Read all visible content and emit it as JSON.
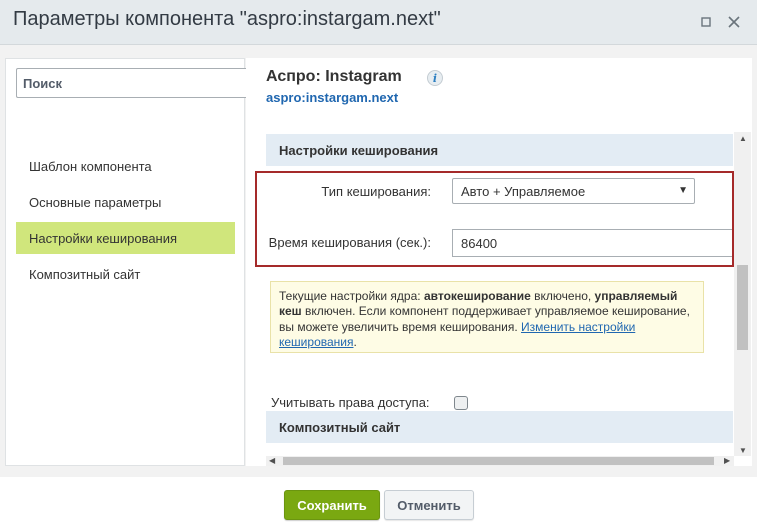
{
  "window": {
    "title": "Параметры компонента \"aspro:instargam.next\"",
    "maximize_icon": "maximize-icon",
    "close_icon": "close-icon"
  },
  "sidebar": {
    "search_placeholder": "Поиск",
    "items": [
      {
        "label": "Шаблон компонента",
        "active": false
      },
      {
        "label": "Основные параметры",
        "active": false
      },
      {
        "label": "Настройки кеширования",
        "active": true
      },
      {
        "label": "Композитный сайт",
        "active": false
      }
    ]
  },
  "component": {
    "title": "Аспро: Instagram",
    "info_glyph": "i",
    "code": "aspro:instargam.next"
  },
  "caching": {
    "section_title": "Настройки кеширования",
    "type_label": "Тип кеширования:",
    "type_value": "Авто + Управляемое",
    "time_label": "Время кеширования (сек.):",
    "time_value": "86400",
    "note_part1": "Текущие настройки ядра: ",
    "note_bold1": "автокеширование",
    "note_part2": " включено, ",
    "note_bold2": "управляемый кеш",
    "note_part3": " включен. Если компонент поддерживает управляемое кеширование, вы можете увеличить время кеширования. ",
    "note_link": "Изменить настройки кеширования",
    "note_end": ".",
    "access_label": "Учитывать права доступа:",
    "access_checked": false
  },
  "composite": {
    "section_title": "Композитный сайт"
  },
  "footer": {
    "save_label": "Сохранить",
    "cancel_label": "Отменить"
  },
  "colors": {
    "active_nav": "#d0e67c",
    "save_button": "#7aa811",
    "section_header": "#e3ecf4",
    "highlight_frame": "#a52a2a",
    "link": "#2067b0"
  }
}
